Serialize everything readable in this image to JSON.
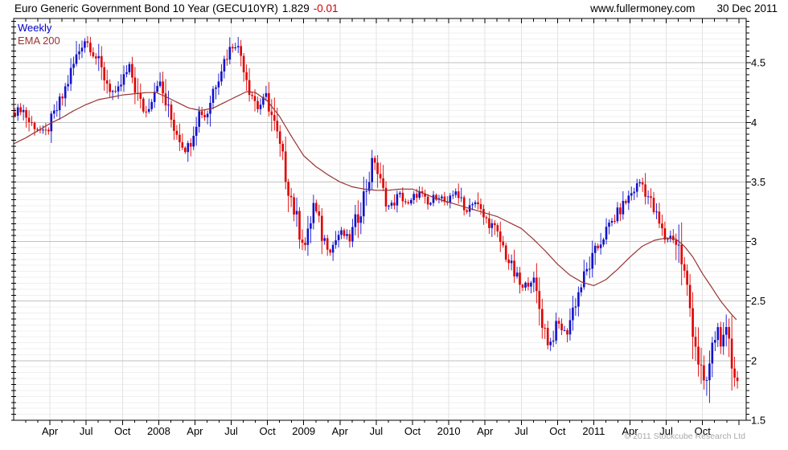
{
  "header": {
    "title": "Euro Generic Government Bond 10 Year (GECU10YR)",
    "last_price": "1.829",
    "change": "-0.01",
    "website": "www.fullermoney.com",
    "date": "30 Dec 2011"
  },
  "legend": {
    "timeframe": "Weekly",
    "overlay": "EMA 200"
  },
  "footer": {
    "copyright": "© 2011 Stockcube Research Ltd"
  },
  "colors": {
    "up_candle": "#1212cc",
    "down_candle": "#e00000",
    "ema_line": "#993333",
    "change_text": "#cc0000",
    "weekly_label": "#0000cc",
    "grid_minor": "#f0f0f0",
    "grid_major": "#c2c2c2",
    "grid_vertical": "#e3e3e3",
    "axis": "#000000",
    "copyright_text": "#a9a9a9"
  },
  "chart_data": {
    "type": "candlestick",
    "timeframe": "weekly",
    "title": "Euro Generic Government Bond 10 Year (GECU10YR)",
    "last_close": 1.829,
    "change": -0.01,
    "overlay": "EMA 200",
    "x_unit": "months_since_Jan_2007",
    "x_range_months": [
      0,
      60.7
    ],
    "ylim": [
      1.5,
      4.872
    ],
    "grid_minor_step": 0.05,
    "grid_major_step": 0.5,
    "y_tick_labels": [
      {
        "label": "4.5",
        "value": 4.5
      },
      {
        "label": "4",
        "value": 4.0
      },
      {
        "label": "3.5",
        "value": 3.5
      },
      {
        "label": "3",
        "value": 3.0
      },
      {
        "label": "2.5",
        "value": 2.5
      },
      {
        "label": "2",
        "value": 2.0
      },
      {
        "label": "1.5",
        "value": 1.5
      }
    ],
    "x_tick_labels": [
      {
        "label": "Apr",
        "month": 3
      },
      {
        "label": "Jul",
        "month": 6
      },
      {
        "label": "Oct",
        "month": 9
      },
      {
        "label": "2008",
        "month": 12
      },
      {
        "label": "Apr",
        "month": 15
      },
      {
        "label": "Jul",
        "month": 18
      },
      {
        "label": "Oct",
        "month": 21
      },
      {
        "label": "2009",
        "month": 24
      },
      {
        "label": "Apr",
        "month": 27
      },
      {
        "label": "Jul",
        "month": 30
      },
      {
        "label": "Oct",
        "month": 33
      },
      {
        "label": "2010",
        "month": 36
      },
      {
        "label": "Apr",
        "month": 39
      },
      {
        "label": "Jul",
        "month": 42
      },
      {
        "label": "Oct",
        "month": 45
      },
      {
        "label": "2011",
        "month": 48
      },
      {
        "label": "Apr",
        "month": 51
      },
      {
        "label": "Jul",
        "month": 54
      },
      {
        "label": "Oct",
        "month": 57
      }
    ],
    "weeks": 260,
    "close_path_anchors": [
      [
        0,
        4.08
      ],
      [
        0.7,
        4.12
      ],
      [
        1.3,
        4.0
      ],
      [
        2.0,
        3.95
      ],
      [
        2.6,
        3.9
      ],
      [
        3.3,
        4.05
      ],
      [
        4.0,
        4.2
      ],
      [
        4.6,
        4.38
      ],
      [
        5.2,
        4.55
      ],
      [
        5.8,
        4.7
      ],
      [
        6.3,
        4.65
      ],
      [
        6.8,
        4.55
      ],
      [
        7.4,
        4.4
      ],
      [
        8.0,
        4.28
      ],
      [
        8.5,
        4.22
      ],
      [
        9.0,
        4.35
      ],
      [
        9.6,
        4.46
      ],
      [
        10.3,
        4.2
      ],
      [
        10.9,
        4.07
      ],
      [
        11.5,
        4.25
      ],
      [
        12.0,
        4.35
      ],
      [
        12.6,
        4.15
      ],
      [
        13.2,
        3.98
      ],
      [
        13.8,
        3.86
      ],
      [
        14.3,
        3.75
      ],
      [
        14.9,
        3.96
      ],
      [
        15.4,
        4.1
      ],
      [
        15.9,
        4.04
      ],
      [
        16.5,
        4.28
      ],
      [
        17.1,
        4.45
      ],
      [
        17.8,
        4.6
      ],
      [
        18.3,
        4.67
      ],
      [
        18.9,
        4.55
      ],
      [
        19.5,
        4.3
      ],
      [
        20.2,
        4.12
      ],
      [
        20.9,
        4.22
      ],
      [
        21.5,
        4.0
      ],
      [
        22.2,
        3.7
      ],
      [
        22.9,
        3.4
      ],
      [
        23.6,
        3.1
      ],
      [
        24.2,
        2.95
      ],
      [
        24.8,
        3.32
      ],
      [
        25.5,
        3.05
      ],
      [
        26.2,
        2.93
      ],
      [
        27.0,
        3.08
      ],
      [
        27.8,
        3.02
      ],
      [
        28.6,
        3.25
      ],
      [
        29.3,
        3.5
      ],
      [
        29.8,
        3.72
      ],
      [
        30.4,
        3.45
      ],
      [
        31.1,
        3.28
      ],
      [
        31.9,
        3.4
      ],
      [
        32.7,
        3.3
      ],
      [
        33.5,
        3.42
      ],
      [
        34.3,
        3.3
      ],
      [
        35.1,
        3.4
      ],
      [
        35.9,
        3.3
      ],
      [
        36.6,
        3.44
      ],
      [
        37.3,
        3.25
      ],
      [
        38.1,
        3.35
      ],
      [
        38.9,
        3.2
      ],
      [
        39.7,
        3.12
      ],
      [
        40.5,
        2.95
      ],
      [
        41.3,
        2.75
      ],
      [
        42.1,
        2.6
      ],
      [
        42.9,
        2.7
      ],
      [
        43.6,
        2.4
      ],
      [
        44.3,
        2.12
      ],
      [
        45.0,
        2.32
      ],
      [
        45.7,
        2.22
      ],
      [
        46.4,
        2.48
      ],
      [
        47.2,
        2.7
      ],
      [
        48.0,
        2.88
      ],
      [
        48.8,
        3.05
      ],
      [
        49.6,
        3.18
      ],
      [
        50.4,
        3.3
      ],
      [
        51.2,
        3.42
      ],
      [
        51.9,
        3.51
      ],
      [
        52.5,
        3.38
      ],
      [
        53.2,
        3.2
      ],
      [
        53.9,
        3.02
      ],
      [
        54.5,
        3.05
      ],
      [
        55.1,
        2.93
      ],
      [
        55.7,
        2.6
      ],
      [
        56.2,
        2.3
      ],
      [
        56.7,
        1.98
      ],
      [
        57.2,
        1.75
      ],
      [
        57.7,
        2.02
      ],
      [
        58.2,
        2.3
      ],
      [
        58.6,
        2.12
      ],
      [
        59.0,
        2.22
      ],
      [
        59.4,
        1.98
      ],
      [
        59.93,
        1.829
      ]
    ],
    "ema_path_anchors": [
      [
        0,
        3.82
      ],
      [
        1,
        3.87
      ],
      [
        2,
        3.93
      ],
      [
        3,
        3.99
      ],
      [
        4,
        4.04
      ],
      [
        5,
        4.1
      ],
      [
        6,
        4.15
      ],
      [
        7,
        4.19
      ],
      [
        8,
        4.21
      ],
      [
        9,
        4.23
      ],
      [
        10,
        4.24
      ],
      [
        11,
        4.25
      ],
      [
        11.8,
        4.25
      ],
      [
        12.5,
        4.22
      ],
      [
        13.5,
        4.17
      ],
      [
        14.5,
        4.12
      ],
      [
        15.5,
        4.1
      ],
      [
        16.5,
        4.12
      ],
      [
        17.5,
        4.17
      ],
      [
        18.5,
        4.22
      ],
      [
        19.3,
        4.26
      ],
      [
        20,
        4.25
      ],
      [
        21,
        4.18
      ],
      [
        22,
        4.05
      ],
      [
        23,
        3.88
      ],
      [
        24,
        3.72
      ],
      [
        25,
        3.63
      ],
      [
        26,
        3.56
      ],
      [
        27,
        3.5
      ],
      [
        28,
        3.46
      ],
      [
        29,
        3.44
      ],
      [
        30,
        3.43
      ],
      [
        31,
        3.43
      ],
      [
        32,
        3.44
      ],
      [
        33,
        3.44
      ],
      [
        34,
        3.4
      ],
      [
        35,
        3.36
      ],
      [
        36,
        3.33
      ],
      [
        37,
        3.3
      ],
      [
        38,
        3.27
      ],
      [
        39,
        3.24
      ],
      [
        40,
        3.21
      ],
      [
        41,
        3.16
      ],
      [
        42,
        3.11
      ],
      [
        43,
        3.02
      ],
      [
        44,
        2.92
      ],
      [
        45,
        2.81
      ],
      [
        46,
        2.72
      ],
      [
        47,
        2.66
      ],
      [
        48,
        2.63
      ],
      [
        49,
        2.68
      ],
      [
        50,
        2.77
      ],
      [
        51,
        2.87
      ],
      [
        52,
        2.96
      ],
      [
        53,
        3.01
      ],
      [
        54,
        3.03
      ],
      [
        54.8,
        3.02
      ],
      [
        55.5,
        2.96
      ],
      [
        56.2,
        2.87
      ],
      [
        57,
        2.73
      ],
      [
        57.8,
        2.61
      ],
      [
        58.5,
        2.5
      ],
      [
        59.3,
        2.4
      ],
      [
        59.93,
        2.33
      ]
    ]
  }
}
